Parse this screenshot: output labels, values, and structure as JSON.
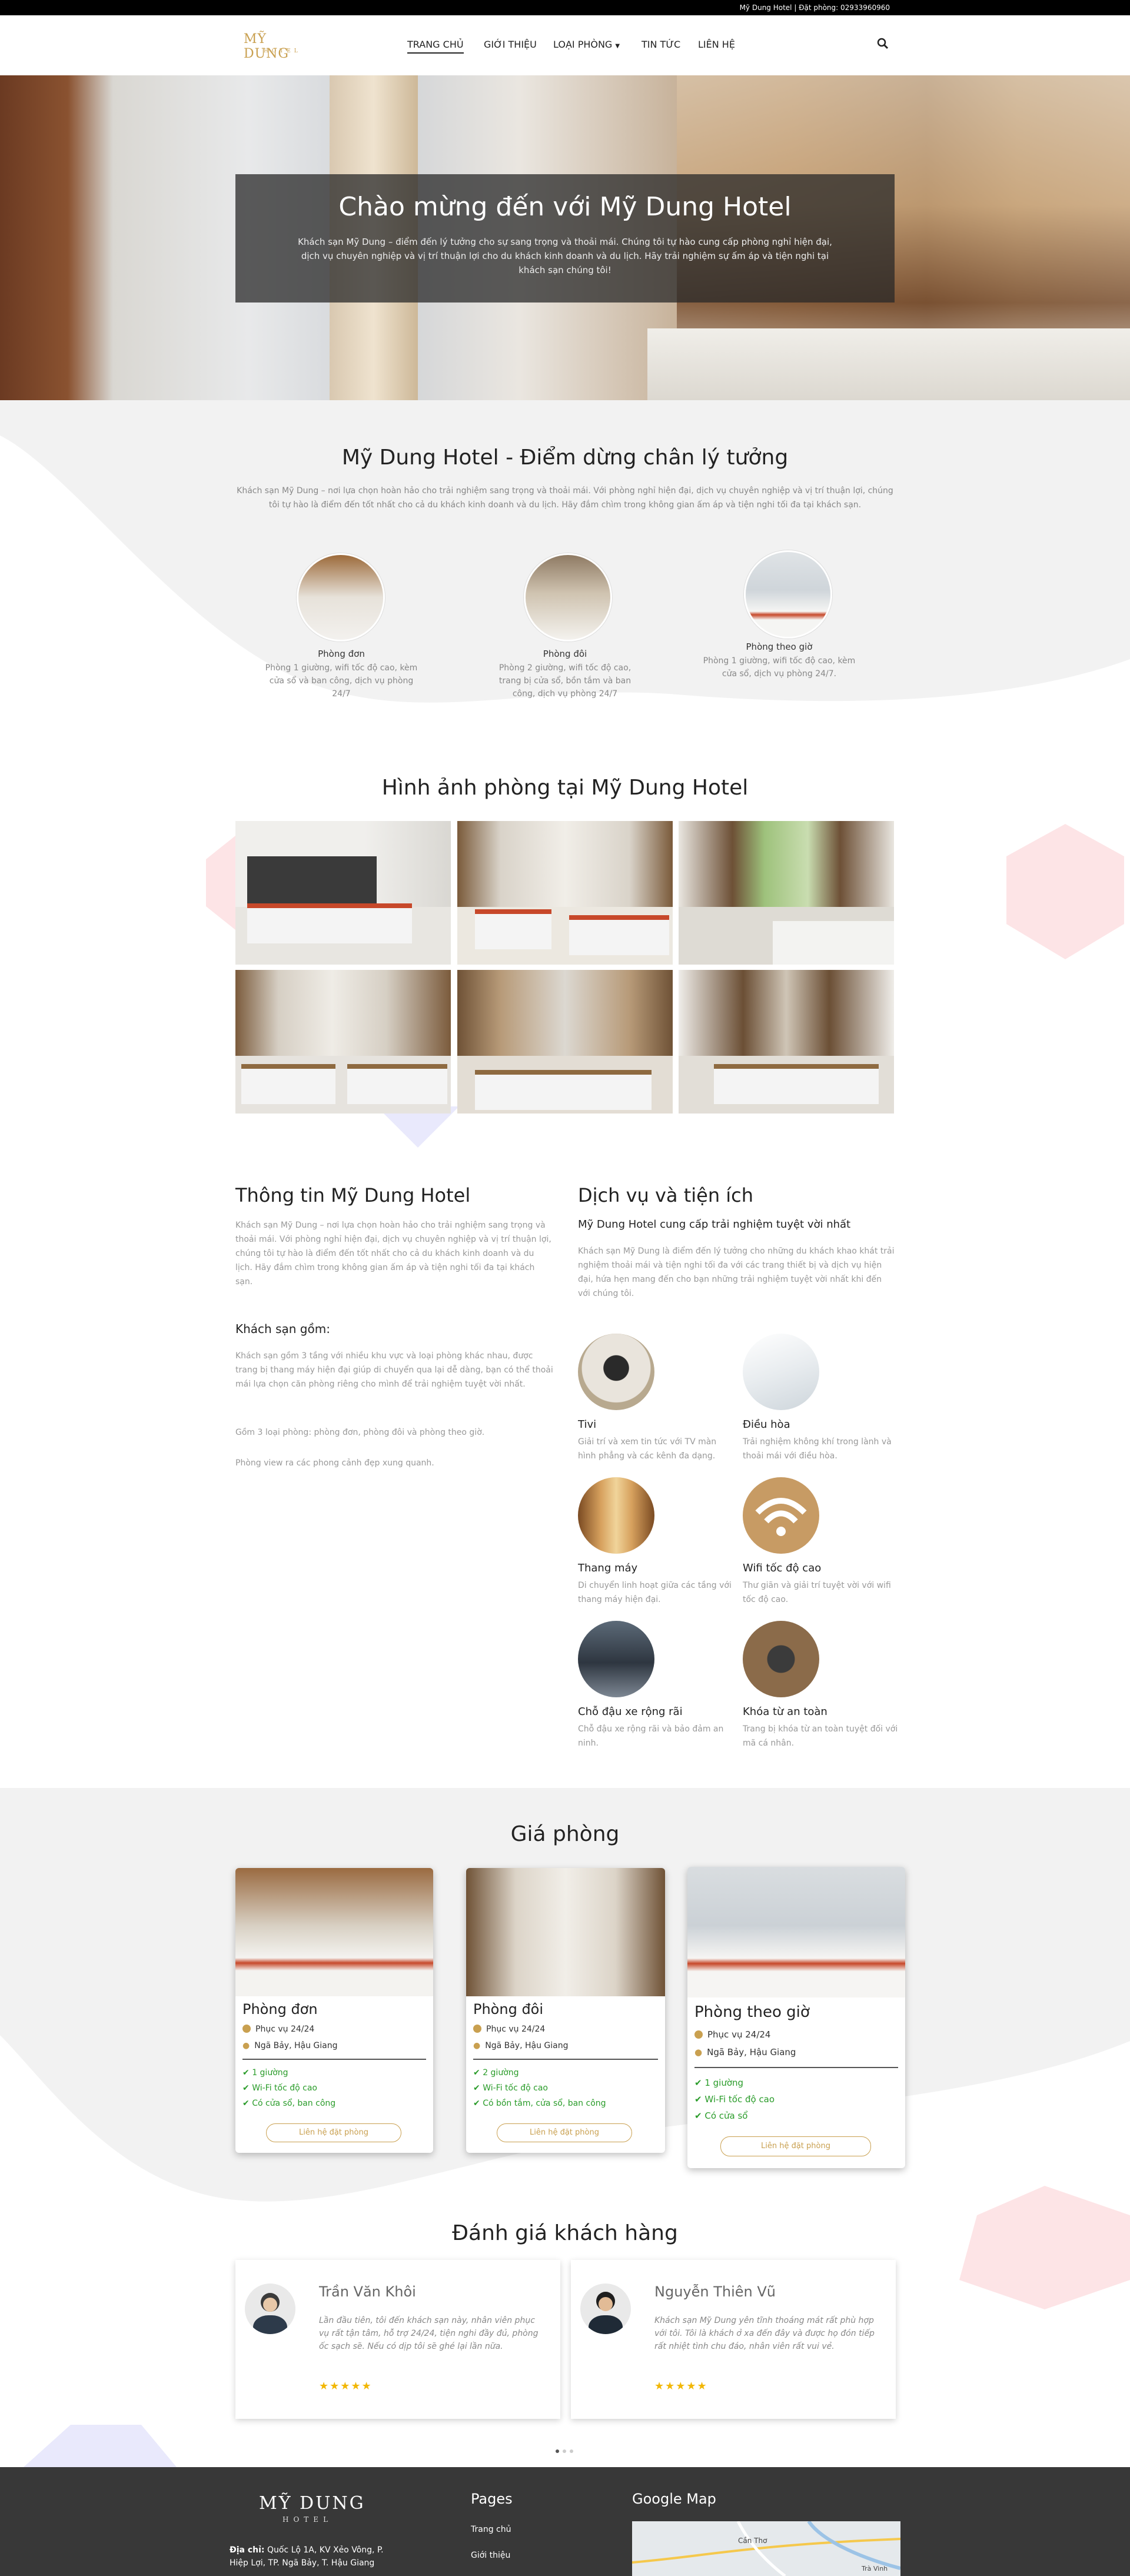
{
  "topbar": {
    "text": "Mỹ Dung Hotel | Đặt phòng: 02933960960"
  },
  "header": {
    "logo_main": "MỸ DUNG",
    "logo_sub": "HOTEL",
    "nav": [
      "TRANG CHỦ",
      "GIỚI THIỆU",
      "LOẠI PHÒNG",
      "TIN TỨC",
      "LIÊN HỆ"
    ]
  },
  "hero": {
    "title": "Chào mừng đến với Mỹ Dung Hotel",
    "text": "Khách sạn Mỹ Dung – điểm đến lý tưởng cho sự sang trọng và thoải mái. Chúng tôi tự hào cung cấp phòng nghỉ hiện đại, dịch vụ chuyên nghiệp và vị trí thuận lợi cho du khách kinh doanh và du lịch. Hãy trải nghiệm sự ấm áp và tiện nghi tại khách sạn chúng tôi!"
  },
  "intro": {
    "title": "Mỹ Dung Hotel - Điểm dừng chân lý tưởng",
    "text": "Khách sạn Mỹ Dung – nơi lựa chọn hoàn hảo cho trải nghiệm sang trọng và thoải mái. Với phòng nghỉ hiện đại, dịch vụ chuyên nghiệp và vị trí thuận lợi, chúng tôi tự hào là điểm đến tốt nhất cho cả du khách kinh doanh và du lịch. Hãy đắm chìm trong không gian ấm áp và tiện nghi tối đa tại khách sạn.",
    "rooms": [
      {
        "name": "Phòng đơn",
        "desc": "Phòng 1 giường, wifi tốc độ cao, kèm cửa sổ và ban công, dịch vụ phòng 24/7"
      },
      {
        "name": "Phòng đôi",
        "desc": "Phòng 2 giường, wifi tốc độ cao, trang bị cửa sổ, bồn tắm và ban công, dịch vụ phòng 24/7"
      },
      {
        "name": "Phòng theo giờ",
        "desc": "Phòng 1 giường, wifi tốc độ cao, kèm cửa sổ, dịch vụ phòng 24/7."
      }
    ]
  },
  "gallery": {
    "title": "Hình ảnh phòng tại Mỹ Dung Hotel"
  },
  "about": {
    "title": "Thông tin Mỹ Dung Hotel",
    "p1": "Khách sạn Mỹ Dung – nơi lựa chọn hoàn hảo cho trải nghiệm sang trọng và thoải mái. Với phòng nghỉ hiện đại, dịch vụ chuyên nghiệp và vị trí thuận lợi, chúng tôi tự hào là điểm đến tốt nhất cho cả du khách kinh doanh và du lịch. Hãy đắm chìm trong không gian ấm áp và tiện nghi tối đa tại khách sạn.",
    "sub": "Khách sạn gồm:",
    "p2": "Khách sạn gồm 3 tầng với nhiều khu vực và loại phòng khác nhau, được trang bị thang máy hiện đại giúp di chuyển qua lại dễ dàng, bạn có thể thoải mái lựa chọn căn phòng riêng cho mình để trải nghiệm tuyệt vời nhất.",
    "p3": "Gồm 3 loại phòng: phòng đơn, phòng đôi và phòng theo giờ.",
    "p4": "Phòng view ra các phong cảnh đẹp xung quanh."
  },
  "services": {
    "title": "Dịch vụ và tiện ích",
    "subtitle": "Mỹ Dung Hotel cung cấp trải nghiệm tuyệt vời nhất",
    "text": "Khách sạn Mỹ Dung là điểm đến lý tưởng cho những du khách khao khát trải nghiệm thoải mái và tiện nghi tối đa với các trang thiết bị và dịch vụ hiện đại, hứa hẹn mang đến cho bạn những trải nghiệm tuyệt vời nhất khi đến với chúng tôi.",
    "items": [
      {
        "name": "Tivi",
        "desc": "Giải trí và xem tin tức với TV màn hình phẳng và các kênh đa dạng."
      },
      {
        "name": "Điều hòa",
        "desc": "Trải nghiệm không khí trong lành và thoải mái với điều hòa."
      },
      {
        "name": "Thang máy",
        "desc": "Di chuyển linh hoạt giữa các tầng với thang máy hiện đại."
      },
      {
        "name": "Wifi tốc độ cao",
        "desc": "Thư giãn và giải trí tuyệt vời với wifi tốc độ cao."
      },
      {
        "name": "Chỗ đậu xe rộng rãi",
        "desc": "Chỗ đậu xe rộng rãi và bảo đảm an ninh."
      },
      {
        "name": "Khóa từ an toàn",
        "desc": "Trang bị khóa từ an toàn tuyệt đối với mã cá nhân."
      }
    ]
  },
  "pricing": {
    "title": "Giá phòng",
    "cards": [
      {
        "name": "Phòng đơn",
        "service": "Phục vụ 24/24",
        "location": "Ngã Bảy, Hậu Giang",
        "features": [
          "1 giường",
          "Wi-Fi tốc độ cao",
          "Có cửa sổ, ban công"
        ],
        "button": "Liên hệ đặt phòng"
      },
      {
        "name": "Phòng đôi",
        "service": "Phục vụ 24/24",
        "location": "Ngã Bảy, Hậu Giang",
        "features": [
          "2 giường",
          "Wi-Fi tốc độ cao",
          "Có bồn tắm, cửa sổ, ban công"
        ],
        "button": "Liên hệ đặt phòng"
      },
      {
        "name": "Phòng theo giờ",
        "service": "Phục vụ 24/24",
        "location": "Ngã Bảy, Hậu Giang",
        "features": [
          "1 giường",
          "Wi-Fi tốc độ cao",
          "Có cửa sổ"
        ],
        "button": "Liên hệ đặt phòng"
      }
    ]
  },
  "reviews": {
    "title": "Đánh giá khách hàng",
    "items": [
      {
        "name": "Trần Văn Khôi",
        "text": "Lần đầu tiên, tôi đến khách sạn này, nhân viên phục vụ rất tận tâm, hỗ trợ 24/24, tiện nghi đầy đủ, phòng ốc sạch sẽ. Nếu có dịp tôi sẽ ghé lại lần nữa.",
        "stars": "★★★★★"
      },
      {
        "name": "Nguyễn Thiên Vũ",
        "text": "Khách sạn Mỹ Dung yên tĩnh thoáng mát rất phù hợp với tôi. Tôi là khách ở xa đến đây và được họ đón tiếp rất nhiệt tình chu đáo, nhân viên rất vui vẻ.",
        "stars": "★★★★★"
      }
    ]
  },
  "footer": {
    "logo_main": "MỸ DUNG",
    "logo_sub": "HOTEL",
    "address_label": "Địa chỉ:",
    "address": "Quốc Lộ 1A, KV Xẻo Vông, P. Hiệp Lợi, TP. Ngã Bảy, T. Hậu Giang",
    "pages_title": "Pages",
    "pages": [
      "Trang chủ",
      "Giới thiệu"
    ],
    "map_title": "Google Map",
    "map_labels": [
      "Cần Thơ",
      "Trà Vinh"
    ]
  },
  "colors": {
    "accent": "#c9a050",
    "dark": "#383838",
    "feature_green": "#2a9c2a"
  }
}
